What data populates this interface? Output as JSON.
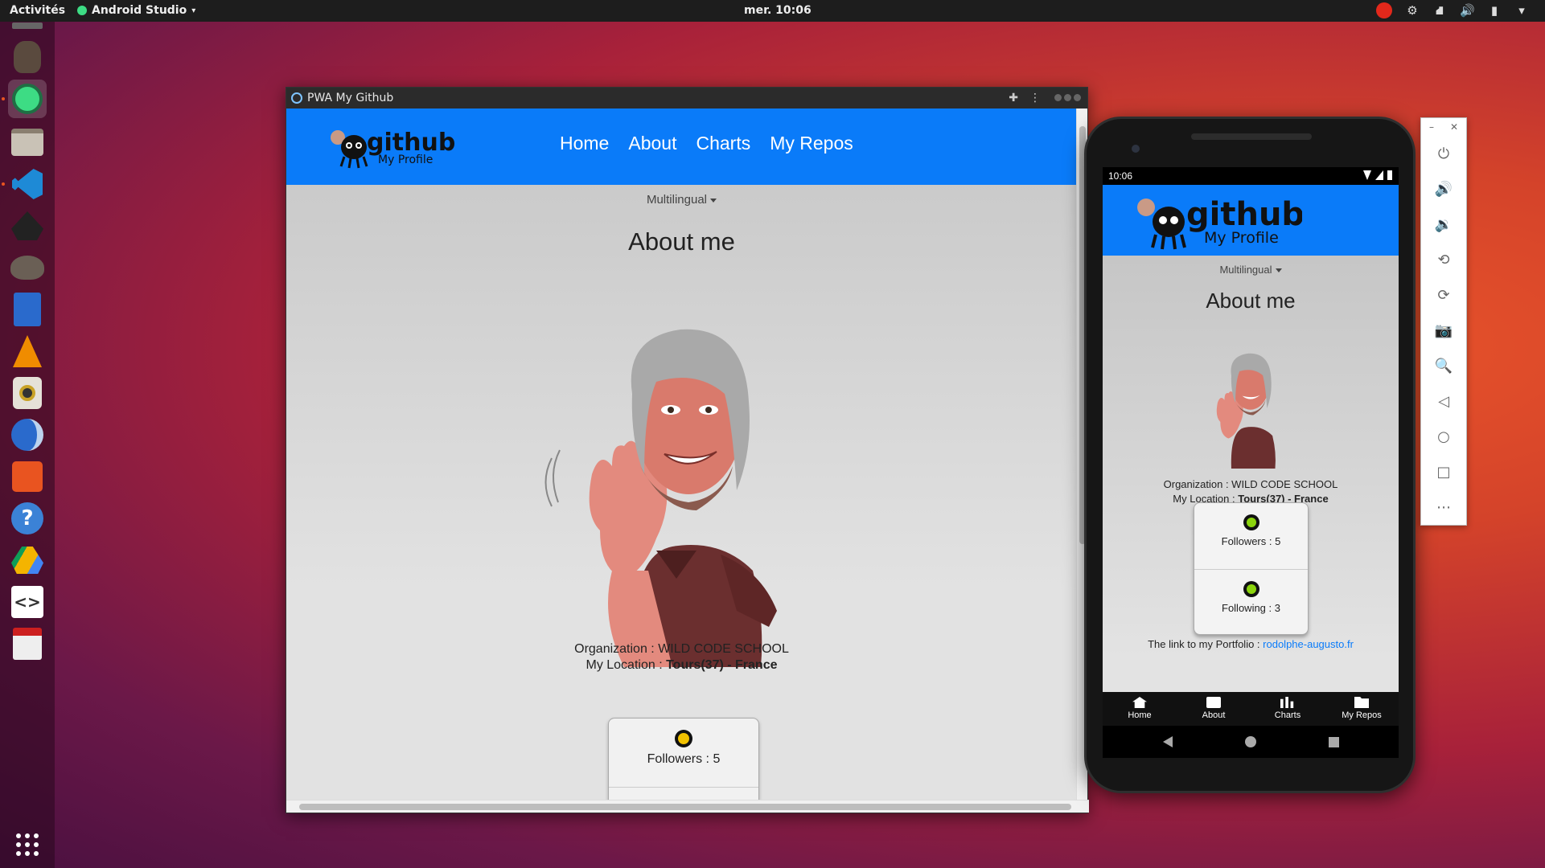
{
  "topbar": {
    "activities": "Activités",
    "app_name": "Android Studio",
    "clock": "mer. 10:06"
  },
  "dock": {
    "items": [
      "dosbox-icon",
      "beaver-icon",
      "android-studio-icon",
      "files-icon",
      "vscode-icon",
      "inkscape-icon",
      "gimp-icon",
      "writer-icon",
      "vlc-icon",
      "speaker-icon",
      "thunderbird-icon",
      "software-icon",
      "help-icon",
      "drive-icon",
      "devtools-icon",
      "evince-icon",
      "app-grid-icon"
    ]
  },
  "browser": {
    "title": "PWA My Github",
    "nav": {
      "logo_main": "github",
      "logo_sub": "My Profile",
      "links": [
        "Home",
        "About",
        "Charts",
        "My Repos"
      ]
    },
    "multilingual": "Multilingual",
    "heading": "About me",
    "org_label": "Organization : ",
    "org_value": "WILD CODE SCHOOL",
    "loc_label": "My Location : ",
    "loc_value": "Tours(37) - France",
    "followers": "Followers : 5"
  },
  "phone": {
    "time": "10:06",
    "logo_main": "github",
    "logo_sub": "My Profile",
    "multilingual": "Multilingual",
    "heading": "About me",
    "org_label": "Organization : ",
    "org_value": "WILD CODE SCHOOL",
    "loc_label": "My Location : ",
    "loc_value": "Tours(37) - France",
    "followers": "Followers : 5",
    "following": "Following : 3",
    "portfolio_label": "The link to my Portfolio : ",
    "portfolio_link": "rodolphe-augusto.fr",
    "tabs": [
      "Home",
      "About",
      "Charts",
      "My Repos"
    ]
  },
  "colors": {
    "brand_blue": "#0a7bf9",
    "ubuntu_orange": "#e95420"
  }
}
